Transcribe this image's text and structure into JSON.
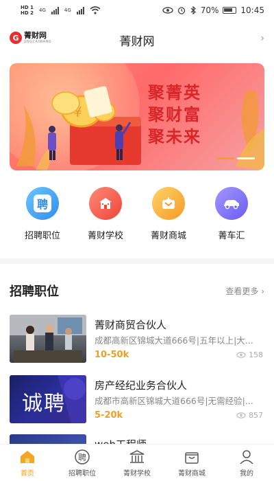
{
  "status": {
    "sim1": "HD 1",
    "sim2": "HD 2",
    "net1": "4G",
    "net2": "4G",
    "battery": "70%",
    "time": "10:45"
  },
  "header": {
    "logo_cn": "菁财网",
    "logo_en": "JINGCAIWANG",
    "title": "菁财网",
    "more_icon": "chevron-right"
  },
  "banner": {
    "lines": [
      "聚菁英",
      "聚财富",
      "聚未来"
    ],
    "slide_count": 2,
    "active_slide": 1,
    "colors": {
      "bg": "#ff6a6a",
      "text": "#d8262b",
      "dot_active": "#f0a020",
      "dot": "#ffffff"
    }
  },
  "quicknav": [
    {
      "label": "招聘职位",
      "icon": "聘",
      "color": "#3da2f5"
    },
    {
      "label": "菁财学校",
      "icon": "school-icon",
      "color": "#f25a4a"
    },
    {
      "label": "菁财商城",
      "icon": "shop-icon",
      "color": "#f6b53a"
    },
    {
      "label": "菁车汇",
      "icon": "car-icon",
      "color": "#7a6cf2"
    }
  ],
  "jobs_section": {
    "title": "招聘职位",
    "more": "查看更多",
    "items": [
      {
        "title": "菁财商贸合伙人",
        "desc": "成都高新区锦城大道666号|五年以上|大...",
        "salary": "10-50k",
        "views": "158"
      },
      {
        "title": "房产经纪业务合伙人",
        "desc": "成都市高新区锦城大道666号|无需经验|...",
        "salary": "5-20k",
        "views": "857"
      },
      {
        "title": "web工程师"
      }
    ],
    "thumb2_text": "诚聘"
  },
  "tabbar": [
    {
      "label": "首页",
      "icon": "home-icon",
      "active": true
    },
    {
      "label": "招聘职位",
      "icon": "recruit-icon",
      "active": false
    },
    {
      "label": "菁财学校",
      "icon": "school-icon",
      "active": false
    },
    {
      "label": "菁财商城",
      "icon": "shop-icon",
      "active": false
    },
    {
      "label": "我的",
      "icon": "user-icon",
      "active": false
    }
  ]
}
